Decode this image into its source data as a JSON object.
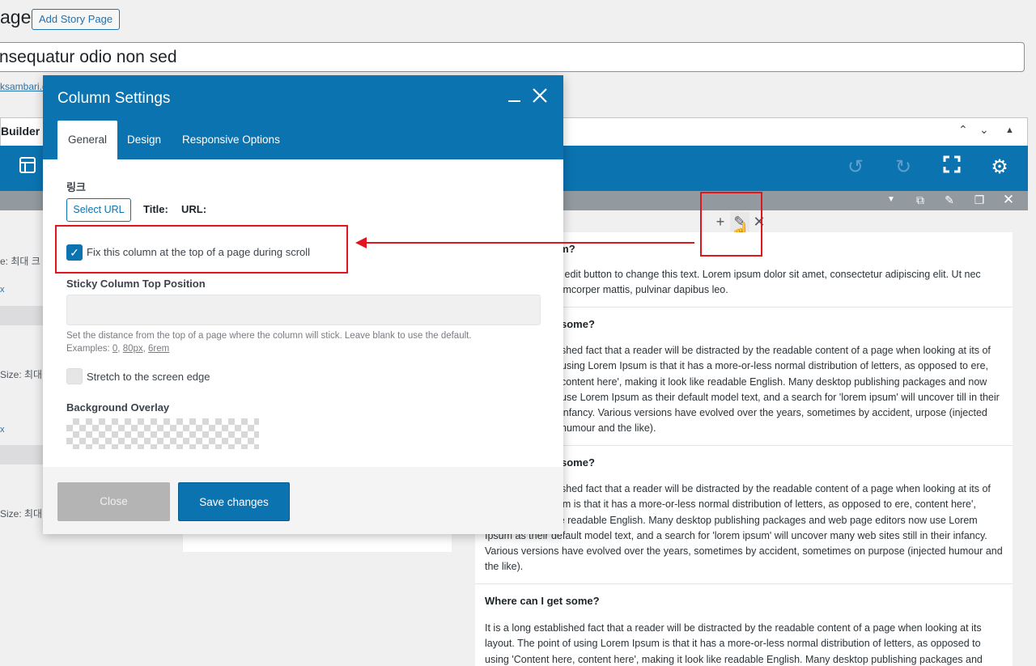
{
  "page": {
    "heading_fragment": "age",
    "add_story_label": "Add Story Page",
    "title_value": "nsequatur odio non sed",
    "permalink_fragment": "ksambari.c",
    "builder_label": "Builder"
  },
  "toolbar": {
    "icons": [
      "layout-icon",
      "undo-icon",
      "redo-icon",
      "fullscreen-icon",
      "gear-icon"
    ]
  },
  "left_fragments": {
    "size_a": "e: 최대 크",
    "size_b": "Size: 최대",
    "size_c": "Size: 최대",
    "px_a": "x",
    "px_b": "x"
  },
  "faq": [
    {
      "title": "sum?",
      "body": "lick edit button to change this text. Lorem ipsum dolor sit amet, consectetur adipiscing elit. Ut nec ullamcorper mattis, pulvinar dapibus leo."
    },
    {
      "title": "some?",
      "body": "shed fact that a reader will be distracted by the readable content of a page when looking at its of using Lorem Ipsum is that it has a more-or-less normal distribution of letters, as opposed to ere, content here', making it look like readable English. Many desktop publishing packages and now use Lorem Ipsum as their default model text, and a search for 'lorem ipsum' will uncover till in their infancy. Various versions have evolved over the years, sometimes by accident, urpose (injected humour and the like)."
    },
    {
      "title": "some?",
      "body": "shed fact that a reader will be distracted by the readable content of a page when looking at its of using Lorem Ipsum is that it has a more-or-less normal distribution of letters, as opposed to ere, content here', making it look like readable English. Many desktop publishing packages and web page editors now use Lorem Ipsum as their default model text, and a search for 'lorem ipsum' will uncover many web sites still in their infancy. Various versions have evolved over the years, sometimes by accident, sometimes on purpose (injected humour and the like)."
    },
    {
      "title": "Where can I get some?",
      "body": "It is a long established fact that a reader will be distracted by the readable content of a page when looking at its layout. The point of using Lorem Ipsum is that it has a more-or-less normal distribution of letters, as opposed to using 'Content here, content here', making it look like readable English. Many desktop publishing packages and"
    }
  ],
  "modal": {
    "title": "Column Settings",
    "tabs": [
      "General",
      "Design",
      "Responsive Options"
    ],
    "active_tab": "General",
    "link_label": "링크",
    "select_url_label": "Select URL",
    "title_meta_label": "Title:",
    "url_meta_label": "URL:",
    "sticky_checkbox_label": "Fix this column at the top of a page during scroll",
    "sticky_checked": true,
    "sticky_position_label": "Sticky Column Top Position",
    "sticky_position_value": "",
    "help_text": "Set the distance from the top of a page where the column will stick. Leave blank to use the default.",
    "examples_prefix": "Examples:",
    "examples": [
      "0",
      "80px",
      "6rem"
    ],
    "stretch_label": "Stretch to the screen edge",
    "stretch_checked": false,
    "overlay_label": "Background Overlay",
    "close_label": "Close",
    "save_label": "Save changes"
  },
  "colors": {
    "brand_blue": "#0b73b0",
    "annotation_red": "#e0151f"
  }
}
